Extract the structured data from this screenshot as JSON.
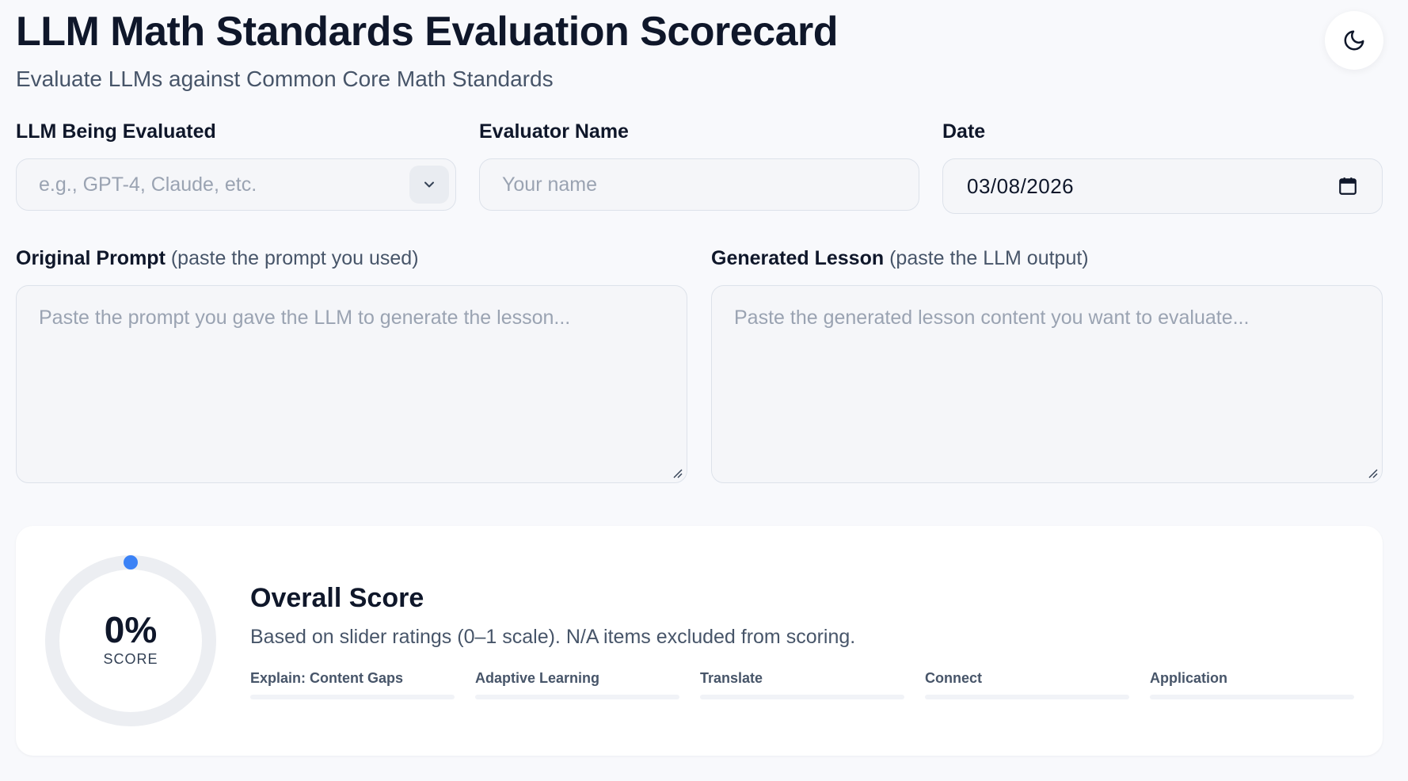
{
  "header": {
    "title": "LLM Math Standards Evaluation Scorecard",
    "subtitle": "Evaluate LLMs against Common Core Math Standards",
    "theme_toggle_icon": "moon-icon"
  },
  "form": {
    "llm": {
      "label": "LLM Being Evaluated",
      "placeholder": "e.g., GPT-4, Claude, etc.",
      "value": ""
    },
    "evaluator": {
      "label": "Evaluator Name",
      "placeholder": "Your name",
      "value": ""
    },
    "date": {
      "label": "Date",
      "value": "03/08/2026",
      "icon": "calendar-icon"
    },
    "prompt": {
      "label": "Original Prompt",
      "hint": "(paste the prompt you used)",
      "placeholder": "Paste the prompt you gave the LLM to generate the lesson..."
    },
    "lesson": {
      "label": "Generated Lesson",
      "hint": "(paste the LLM output)",
      "placeholder": "Paste the generated lesson content you want to evaluate..."
    }
  },
  "score": {
    "value": "0%",
    "percent": 0,
    "caption": "SCORE",
    "title": "Overall Score",
    "description": "Based on slider ratings (0–1 scale). N/A items excluded from scoring.",
    "categories": [
      {
        "label": "Explain: Content Gaps",
        "progress": 0
      },
      {
        "label": "Adaptive Learning",
        "progress": 0
      },
      {
        "label": "Translate",
        "progress": 0
      },
      {
        "label": "Connect",
        "progress": 0
      },
      {
        "label": "Application",
        "progress": 0
      }
    ]
  },
  "colors": {
    "accent": "#3b82f6",
    "ring_track": "#eceef2",
    "text": "#0f172a"
  }
}
